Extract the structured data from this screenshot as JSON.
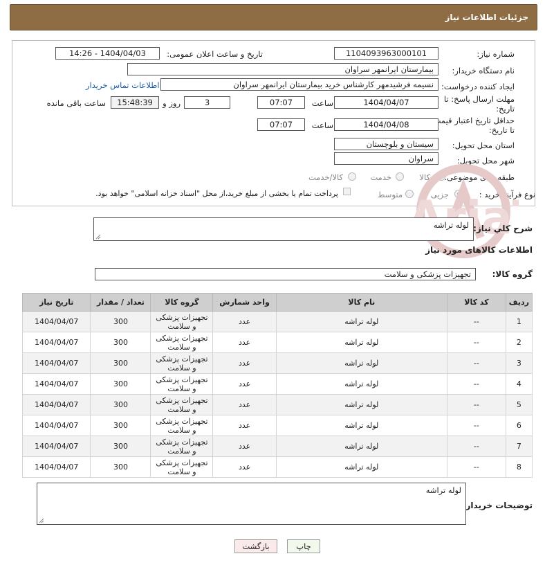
{
  "header": {
    "title": "جزئیات اطلاعات نیاز"
  },
  "form": {
    "need_number_label": "شماره نیاز:",
    "need_number": "1104093963000101",
    "announce_label": "تاریخ و ساعت اعلان عمومی:",
    "announce_value": "1404/04/03 - 14:26",
    "buyer_org_label": "نام دستگاه خریدار:",
    "buyer_org": "بیمارستان ایرانمهر سراوان",
    "creator_label": "ایجاد کننده درخواست:",
    "creator": "نسیمه فرشیدمهر کارشناس خرید بیمارستان ایرانمهر سراوان",
    "contact_link": "اطلاعات تماس خریدار",
    "reply_deadline_label_1": "مهلت ارسال پاسخ: تا",
    "reply_deadline_label_2": "تاریخ:",
    "reply_date": "1404/04/07",
    "time_label": "ساعت",
    "reply_time": "07:07",
    "days": "3",
    "days_label": "روز و",
    "remaining": "15:48:39",
    "remaining_label": "ساعت باقی مانده",
    "price_valid_label_1": "حداقل تاریخ اعتبار قیمت:",
    "price_valid_label_2": "تا تاریخ:",
    "price_valid_date": "1404/04/08",
    "price_valid_time": "07:07",
    "province_label": "استان محل تحویل:",
    "province": "سیستان و بلوچستان",
    "city_label": "شهر محل تحویل:",
    "city": "سراوان",
    "category_label": "طبقه بندی موضوعی:",
    "category_options": [
      "کالا",
      "خدمت",
      "کالا/خدمت"
    ],
    "purchase_type_label": "نوع فرآیند خرید :",
    "purchase_options": [
      "جزیی",
      "متوسط"
    ],
    "payment_note": "پرداخت تمام یا بخشی از مبلغ خرید،از محل \"اسناد خزانه اسلامی\" خواهد بود."
  },
  "description": {
    "label": "شرح کلي نياز:",
    "value": "لوله تراشه"
  },
  "goods_section_title": "اطلاعات کالاهای مورد نیاز",
  "goods_group": {
    "label": "گروه کالا:",
    "value": "تجهیزات پزشکی و سلامت"
  },
  "table": {
    "headers": [
      "ردیف",
      "کد کالا",
      "نام کالا",
      "واحد شمارش",
      "گروه کالا",
      "تعداد / مقدار",
      "تاریخ نیاز"
    ],
    "rows": [
      [
        "1",
        "--",
        "لوله تراشه",
        "عدد",
        "تجهیزات پزشکی و سلامت",
        "300",
        "1404/04/07"
      ],
      [
        "2",
        "--",
        "لوله تراشه",
        "عدد",
        "تجهیزات پزشکی و سلامت",
        "300",
        "1404/04/07"
      ],
      [
        "3",
        "--",
        "لوله تراشه",
        "عدد",
        "تجهیزات پزشکی و سلامت",
        "300",
        "1404/04/07"
      ],
      [
        "4",
        "--",
        "لوله تراشه",
        "عدد",
        "تجهیزات پزشکی و سلامت",
        "300",
        "1404/04/07"
      ],
      [
        "5",
        "--",
        "لوله تراشه",
        "عدد",
        "تجهیزات پزشکی و سلامت",
        "300",
        "1404/04/07"
      ],
      [
        "6",
        "--",
        "لوله تراشه",
        "عدد",
        "تجهیزات پزشکی و سلامت",
        "300",
        "1404/04/07"
      ],
      [
        "7",
        "--",
        "لوله تراشه",
        "عدد",
        "تجهیزات پزشکی و سلامت",
        "300",
        "1404/04/07"
      ],
      [
        "8",
        "--",
        "لوله تراشه",
        "عدد",
        "تجهیزات پزشکی و سلامت",
        "300",
        "1404/04/07"
      ]
    ]
  },
  "buyer_notes": {
    "label": "توضیحات خریدار:",
    "value": "لوله تراشه"
  },
  "buttons": {
    "print": "چاپ",
    "back": "بازگشت"
  },
  "watermark": {
    "text": "AriaTender.net",
    "color": "#e6c9c9"
  },
  "colors": {
    "header_bg": "#8e6d45",
    "link": "#1a5ea8",
    "table_header": "#cfcfcf"
  }
}
